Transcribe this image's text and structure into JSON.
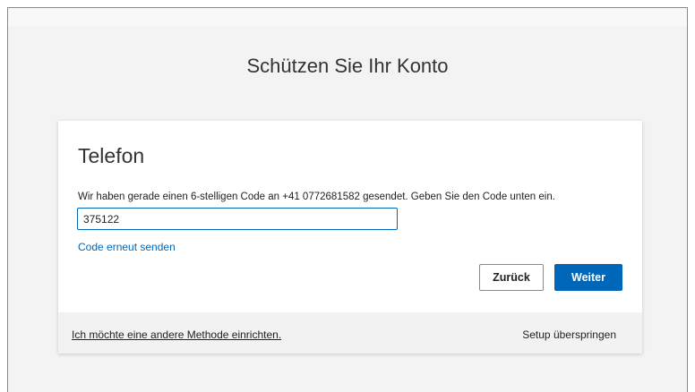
{
  "page": {
    "title": "Schützen Sie Ihr Konto"
  },
  "card": {
    "heading": "Telefon",
    "description": "Wir haben gerade einen 6-stelligen Code an +41 0772681582 gesendet. Geben Sie den Code unten ein.",
    "code_input": {
      "value": "375122",
      "placeholder": ""
    },
    "resend_link": "Code erneut senden",
    "back_button": "Zurück",
    "next_button": "Weiter"
  },
  "footer": {
    "other_method_link": "Ich möchte eine andere Methode einrichten.",
    "skip_setup": "Setup überspringen"
  },
  "colors": {
    "accent": "#0067b8",
    "background": "#f3f3f3",
    "card": "#ffffff",
    "footer": "#f2f2f2"
  }
}
